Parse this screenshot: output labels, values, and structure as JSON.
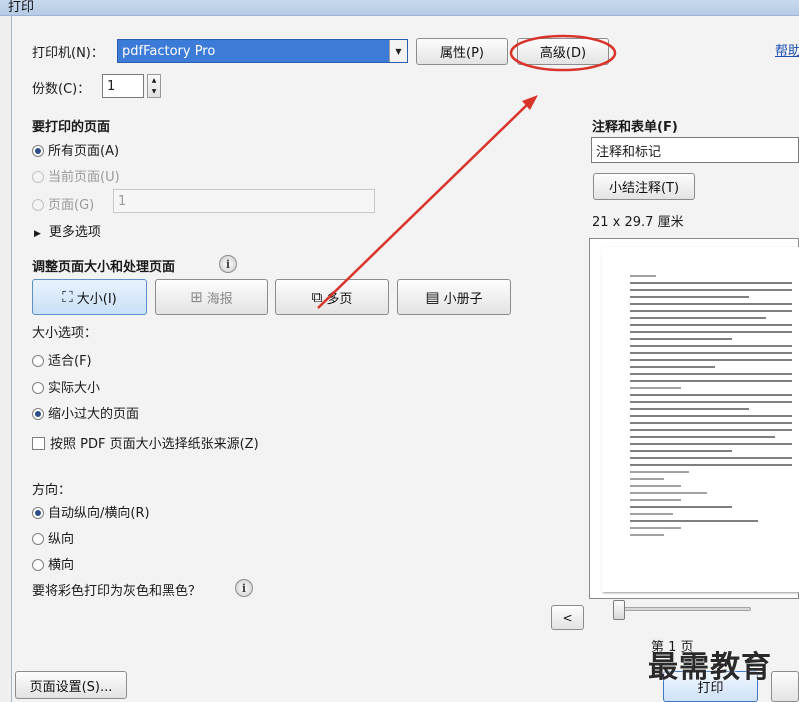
{
  "window": {
    "title": "打印"
  },
  "printer": {
    "label": "打印机(N)：",
    "selected": "pdfFactory Pro",
    "properties_button": "属性(P)",
    "advanced_button": "高级(D)",
    "help_link": "帮助"
  },
  "copies": {
    "label": "份数(C)：",
    "value": "1"
  },
  "pages_to_print": {
    "heading": "要打印的页面",
    "all_pages": "所有页面(A)",
    "current_page": "当前页面(U)",
    "pages": "页面(G)",
    "pages_value": "1",
    "more_options": "更多选项"
  },
  "page_handling": {
    "heading": "调整页面大小和处理页面",
    "buttons": [
      "大小(I)",
      "海报",
      "多页",
      "小册子"
    ],
    "size_options_label": "大小选项：",
    "fit": "适合(F)",
    "actual_size": "实际大小",
    "shrink_oversized": "缩小过大的页面",
    "choose_paper_source": "按照 PDF 页面大小选择纸张来源(Z)"
  },
  "orientation": {
    "label": "方向：",
    "auto": "自动纵向/横向(R)",
    "portrait": "纵向",
    "landscape": "横向"
  },
  "grayscale_question": "要将彩色打印为灰色和黑色？",
  "comments_forms": {
    "heading": "注释和表单(F)",
    "selected": "注释和标记",
    "summarize_button": "小结注释(T)",
    "paper_size": "21 x 29.7 厘米"
  },
  "preview": {
    "page_indicator": "第 1 页",
    "prev_button": "<"
  },
  "footer": {
    "page_setup_button": "页面设置(S)...",
    "print_button": "打印"
  },
  "watermark": "最需教育",
  "colors": {
    "accent": "#3d7bd8",
    "annotation": "#d9342b"
  }
}
